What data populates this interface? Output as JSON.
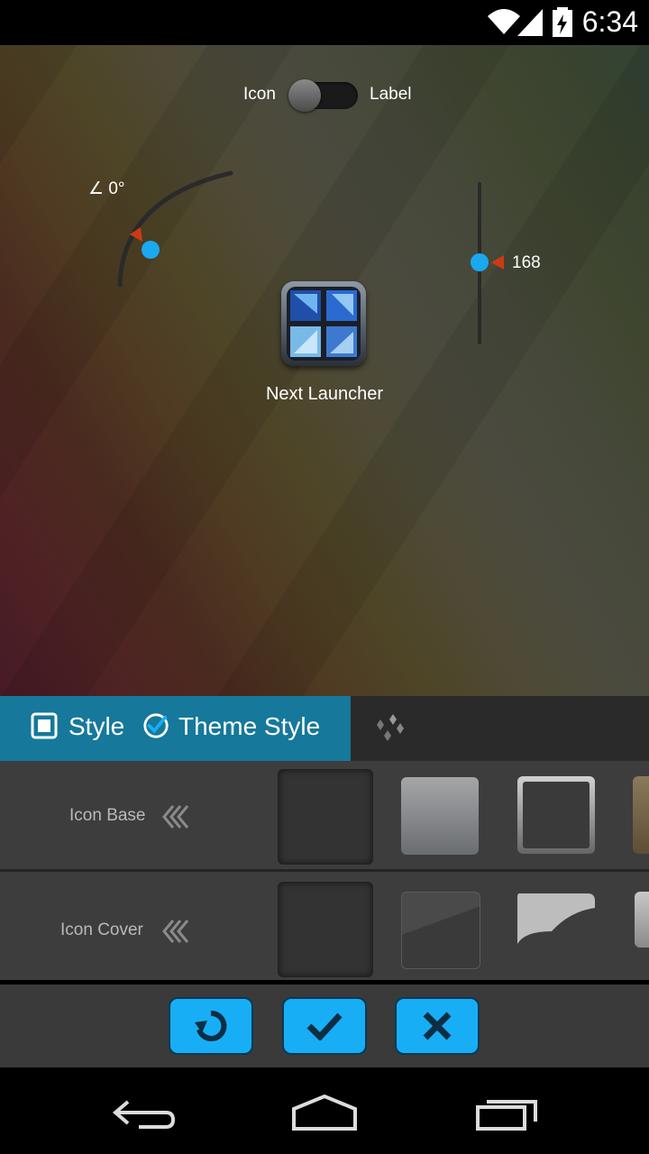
{
  "status_bar": {
    "time": "6:34",
    "icons": [
      "wifi-icon",
      "signal-icon",
      "battery-charging-icon"
    ]
  },
  "editor": {
    "toggle": {
      "left_label": "Icon",
      "right_label": "Label"
    },
    "angle": {
      "value_label": "0°",
      "icon": "angle-icon"
    },
    "size": {
      "value": "168",
      "level": 0.55
    },
    "app": {
      "name": "Next Launcher",
      "icon": "next-launcher-icon"
    }
  },
  "tabs": {
    "style_label": "Style",
    "theme_style_label": "Theme Style",
    "extra_icon": "diamonds-icon"
  },
  "rows": [
    {
      "label": "Icon Base",
      "icon": "double-chevron-left-icon"
    },
    {
      "label": "Icon Cover",
      "icon": "double-chevron-left-icon"
    }
  ],
  "actions": [
    "reset-icon",
    "check-icon",
    "close-icon"
  ],
  "nav": [
    "back-icon",
    "home-icon",
    "recents-icon"
  ],
  "colors": {
    "accent": "#18aef5",
    "tab_active": "#16789a",
    "pointer": "#cc3a14"
  }
}
